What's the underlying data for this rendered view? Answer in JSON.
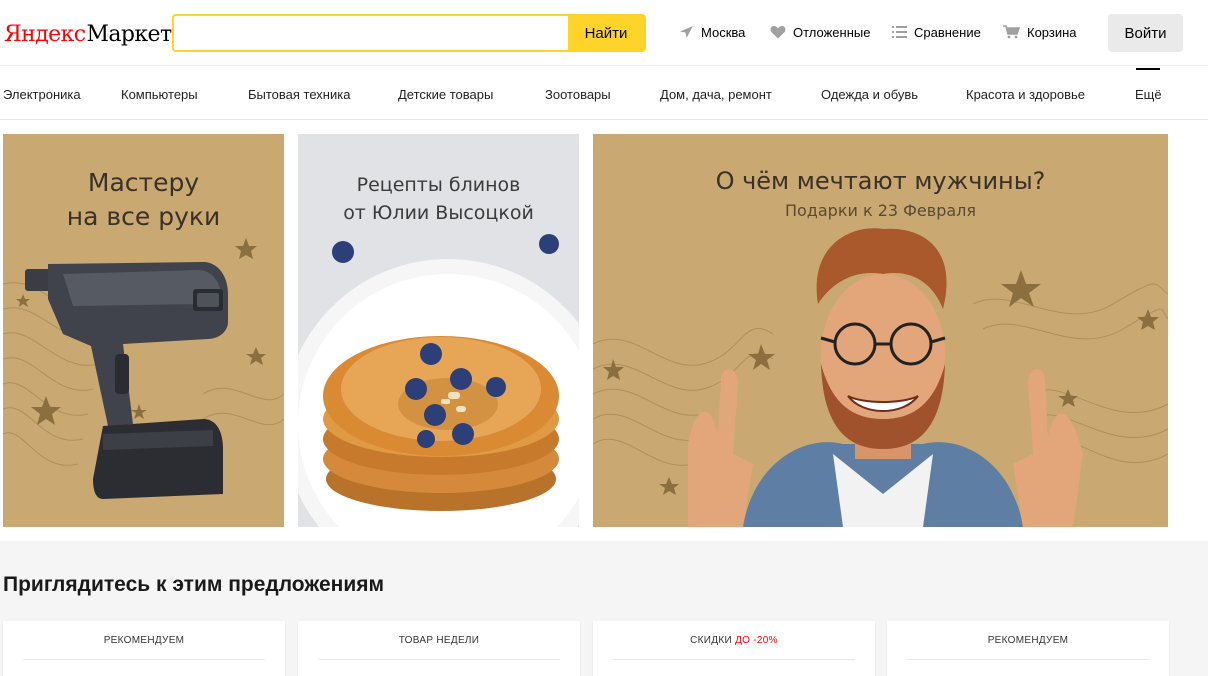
{
  "header": {
    "logo_ya": "Яндекс",
    "logo_market": "Маркет",
    "search": {
      "value": "",
      "placeholder": "",
      "button": "Найти"
    },
    "nav": {
      "city": "Москва",
      "deferred": "Отложенные",
      "compare": "Сравнение",
      "cart": "Корзина"
    },
    "login": "Войти"
  },
  "categories": [
    "Электроника",
    "Компьютеры",
    "Бытовая техника",
    "Детские товары",
    "Зоотовары",
    "Дом, дача, ремонт",
    "Одежда и обувь",
    "Красота и здоровье",
    "Ещё"
  ],
  "banners": {
    "b1": {
      "line1": "Мастеру",
      "line2": "на все руки"
    },
    "b2": {
      "line1": "Рецепты блинов",
      "line2": "от Юлии Высоцкой"
    },
    "b3": {
      "title": "О чём мечтают мужчины?",
      "subtitle": "Подарки к 23 Февраля"
    }
  },
  "offers": {
    "heading": "Приглядитесь к этим предложениям",
    "cards": [
      {
        "label": "Рекомендуем"
      },
      {
        "label": "Товар недели"
      },
      {
        "label": "Скидки",
        "accent": "до -20%"
      },
      {
        "label": "Рекомендуем"
      }
    ]
  },
  "colors": {
    "brand_yellow": "#fed42b",
    "logo_red": "#ff0000",
    "banner_tan": "#c9a971",
    "discount_red": "#ff0000"
  },
  "icons": {
    "city": "location-arrow-icon",
    "deferred": "heart-icon",
    "compare": "compare-list-icon",
    "cart": "cart-icon"
  }
}
